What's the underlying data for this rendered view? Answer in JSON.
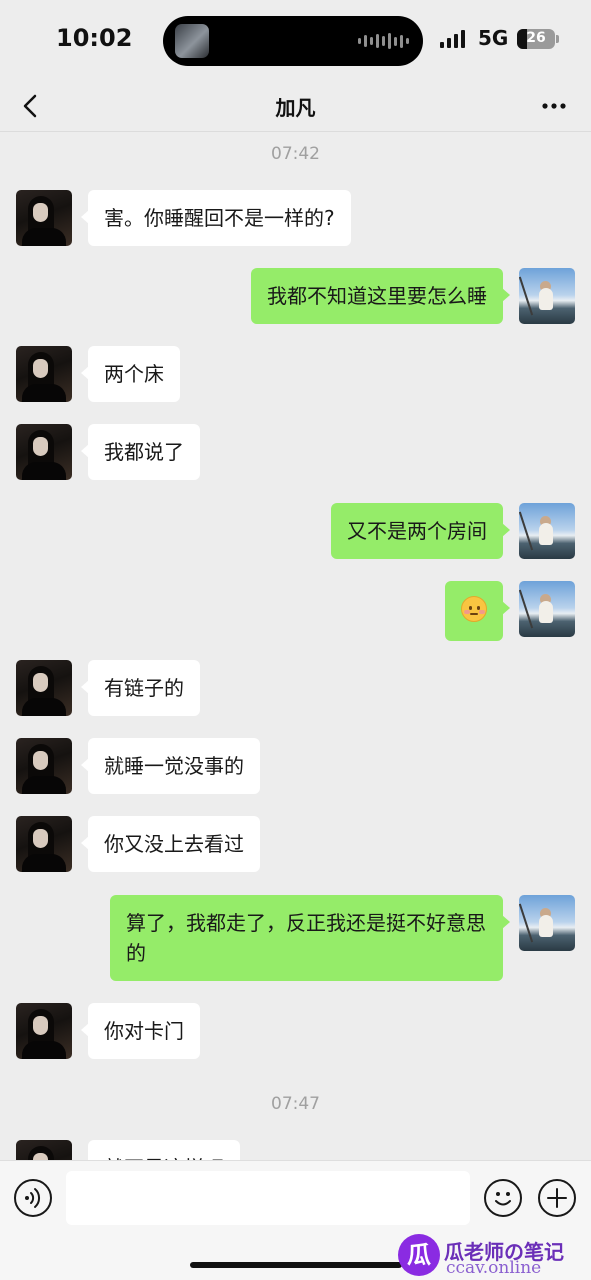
{
  "status_bar": {
    "time": "10:02",
    "network": "5G",
    "battery": "26",
    "battery_level": 0.26
  },
  "nav": {
    "title": "加凡"
  },
  "messages": [
    {
      "type": "time",
      "text": "07:42"
    },
    {
      "side": "left",
      "text": "害。你睡醒回不是一样的?"
    },
    {
      "side": "right",
      "text": "我都不知道这里要怎么睡"
    },
    {
      "side": "left",
      "text": "两个床"
    },
    {
      "side": "left",
      "text": "我都说了"
    },
    {
      "side": "right",
      "text": "又不是两个房间"
    },
    {
      "side": "right",
      "emoji": "blush-face-emoji"
    },
    {
      "side": "left",
      "text": "有链子的"
    },
    {
      "side": "left",
      "text": "就睡一觉没事的"
    },
    {
      "side": "left",
      "text": "你又没上去看过"
    },
    {
      "side": "right",
      "text": "算了，我都走了，反正我还是挺不好意思的"
    },
    {
      "side": "left",
      "text": "你对卡门"
    },
    {
      "type": "time",
      "text": "07:47"
    },
    {
      "side": "left",
      "text": "就不是这样吧",
      "partial": true
    }
  ],
  "input_bar": {
    "value": ""
  },
  "watermark": {
    "title": "瓜老师の笔记",
    "url": "ccav.online",
    "logo_char": "瓜"
  }
}
